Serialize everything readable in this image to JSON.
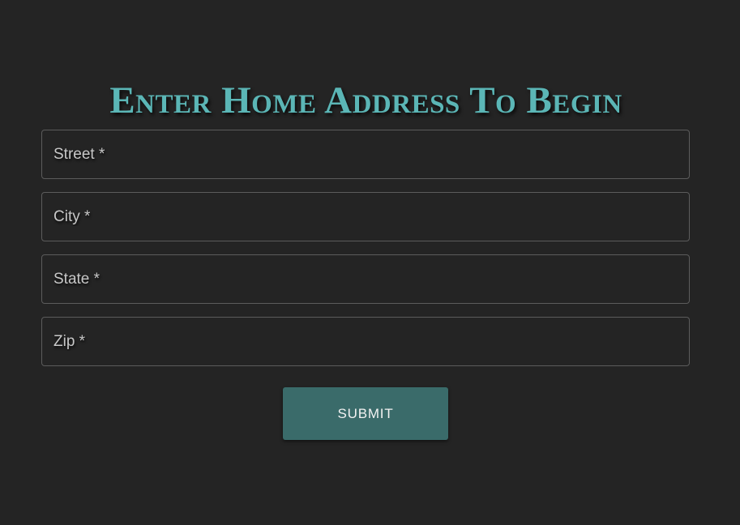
{
  "form": {
    "title": "Enter Home Address To Begin",
    "fields": [
      {
        "name": "street",
        "placeholder": "Street *",
        "value": ""
      },
      {
        "name": "city",
        "placeholder": "City *",
        "value": ""
      },
      {
        "name": "state",
        "placeholder": "State *",
        "value": ""
      },
      {
        "name": "zip",
        "placeholder": "Zip *",
        "value": ""
      }
    ],
    "submit_label": "SUBMIT"
  },
  "colors": {
    "background": "#242424",
    "title": "#5bb6b6",
    "field_border": "#5c5c5c",
    "button": "#3a6b6a",
    "button_text": "#f2f2f2"
  }
}
